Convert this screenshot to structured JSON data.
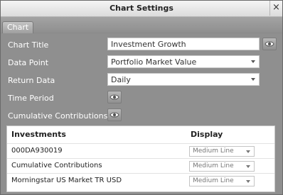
{
  "dialog": {
    "title": "Chart Settings",
    "close_label": "×",
    "tab_label": "Chart"
  },
  "form": {
    "chart_title": {
      "label": "Chart Title",
      "value": "Investment Growth"
    },
    "data_point": {
      "label": "Data Point",
      "value": "Portfolio Market Value"
    },
    "return_data": {
      "label": "Return Data",
      "value": "Daily"
    },
    "time_period": {
      "label": "Time Period"
    },
    "cumulative_contributions": {
      "label": "Cumulative Contributions"
    }
  },
  "investments": {
    "headers": {
      "name": "Investments",
      "display": "Display"
    },
    "rows": [
      {
        "name": "000DA930019",
        "display": "Medium Line"
      },
      {
        "name": "Cumulative Contributions",
        "display": "Medium Line"
      },
      {
        "name": "Morningstar US Market TR USD",
        "display": "Medium Line"
      }
    ]
  },
  "icons": {
    "eye": "eye-icon",
    "caret": "chevron-down-icon",
    "close": "close-icon"
  },
  "colors": {
    "background": "#8f8f8f",
    "titlebar": "#e8e8e8",
    "label_text": "#ffffff",
    "panel": "#ffffff"
  }
}
